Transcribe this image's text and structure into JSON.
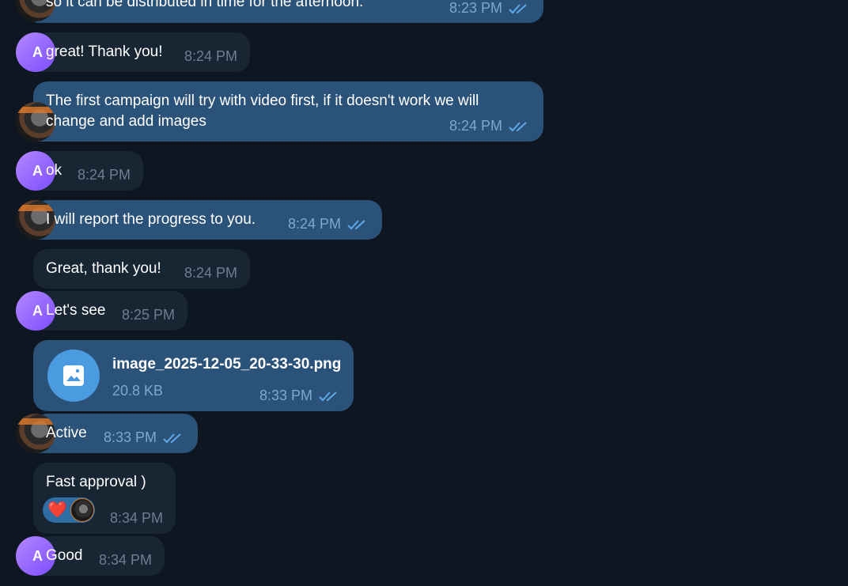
{
  "avatar_letter": "A",
  "colors": {
    "background": "#0e1621",
    "incoming": "#182533",
    "outgoing": "#2b5278",
    "check": "#5fa8e8"
  },
  "messages": [
    {
      "text": "so it can be distributed in time for the afternoon.",
      "time": "8:23 PM",
      "status": "read"
    },
    {
      "text": "great! Thank you!",
      "time": "8:24 PM"
    },
    {
      "text": "The first campaign will try with video first, if it doesn't work we will\nchange and add images",
      "time": "8:24 PM",
      "status": "read"
    },
    {
      "text": "ok",
      "time": "8:24 PM"
    },
    {
      "text": "I will report the progress to you.",
      "time": "8:24 PM",
      "status": "read"
    },
    {
      "text": "Great, thank you!",
      "time": "8:24 PM"
    },
    {
      "text": "Let's see",
      "time": "8:25 PM"
    },
    {
      "file_name": "image_2025-12-05_20-33-30.png",
      "file_size": "20.8 KB",
      "time": "8:33 PM",
      "status": "read",
      "icon": "image-icon"
    },
    {
      "text": "Active",
      "time": "8:33 PM",
      "status": "read"
    },
    {
      "text": "Fast approval )",
      "time": "8:34 PM",
      "reaction": "❤️"
    },
    {
      "text": "Good",
      "time": "8:34 PM"
    }
  ]
}
